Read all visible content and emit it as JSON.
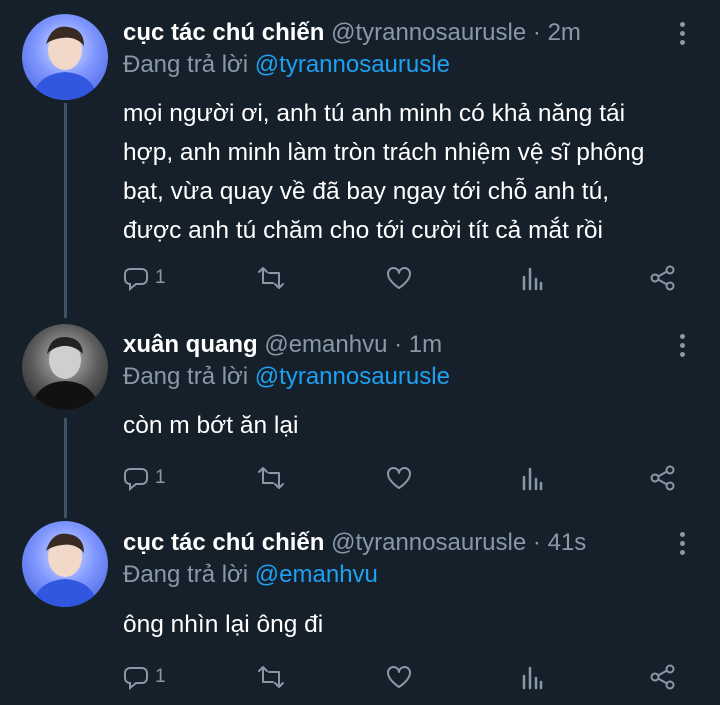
{
  "colors": {
    "background": "#15202b",
    "text": "#ffffff",
    "muted": "#8899a6",
    "link": "#1da1f2"
  },
  "tweets": [
    {
      "name": "cục tác chú chiến",
      "handle": "@tyrannosaurusle",
      "time": "2m",
      "reply_prefix": "Đang trả lời",
      "reply_to": "@tyrannosaurusle",
      "text": [
        "mọi người ơi, anh tú anh minh có khả năng tái",
        "hợp, anh minh làm tròn trách nhiệm vệ sĩ phông",
        "bạt, vừa quay về đã bay ngay tới chỗ anh tú,",
        "được anh tú chăm cho tới cười tít cả mắt rồi"
      ],
      "reply_count": "1",
      "icons": [
        "reply-icon",
        "retweet-icon",
        "like-icon",
        "analytics-icon",
        "share-icon"
      ]
    },
    {
      "name": "xuân quang",
      "handle": "@emanhvu",
      "time": "1m",
      "reply_prefix": "Đang trả lời",
      "reply_to": "@tyrannosaurusle",
      "text": [
        "còn m bớt ăn lại"
      ],
      "reply_count": "1",
      "icons": [
        "reply-icon",
        "retweet-icon",
        "like-icon",
        "analytics-icon",
        "share-icon"
      ]
    },
    {
      "name": "cục tác chú chiến",
      "handle": "@tyrannosaurusle",
      "time": "41s",
      "reply_prefix": "Đang trả lời",
      "reply_to": "@emanhvu",
      "text": [
        "ông nhìn lại ông đi"
      ],
      "reply_count": "1",
      "icons": [
        "reply-icon",
        "retweet-icon",
        "like-icon",
        "analytics-icon",
        "share-icon"
      ]
    }
  ]
}
